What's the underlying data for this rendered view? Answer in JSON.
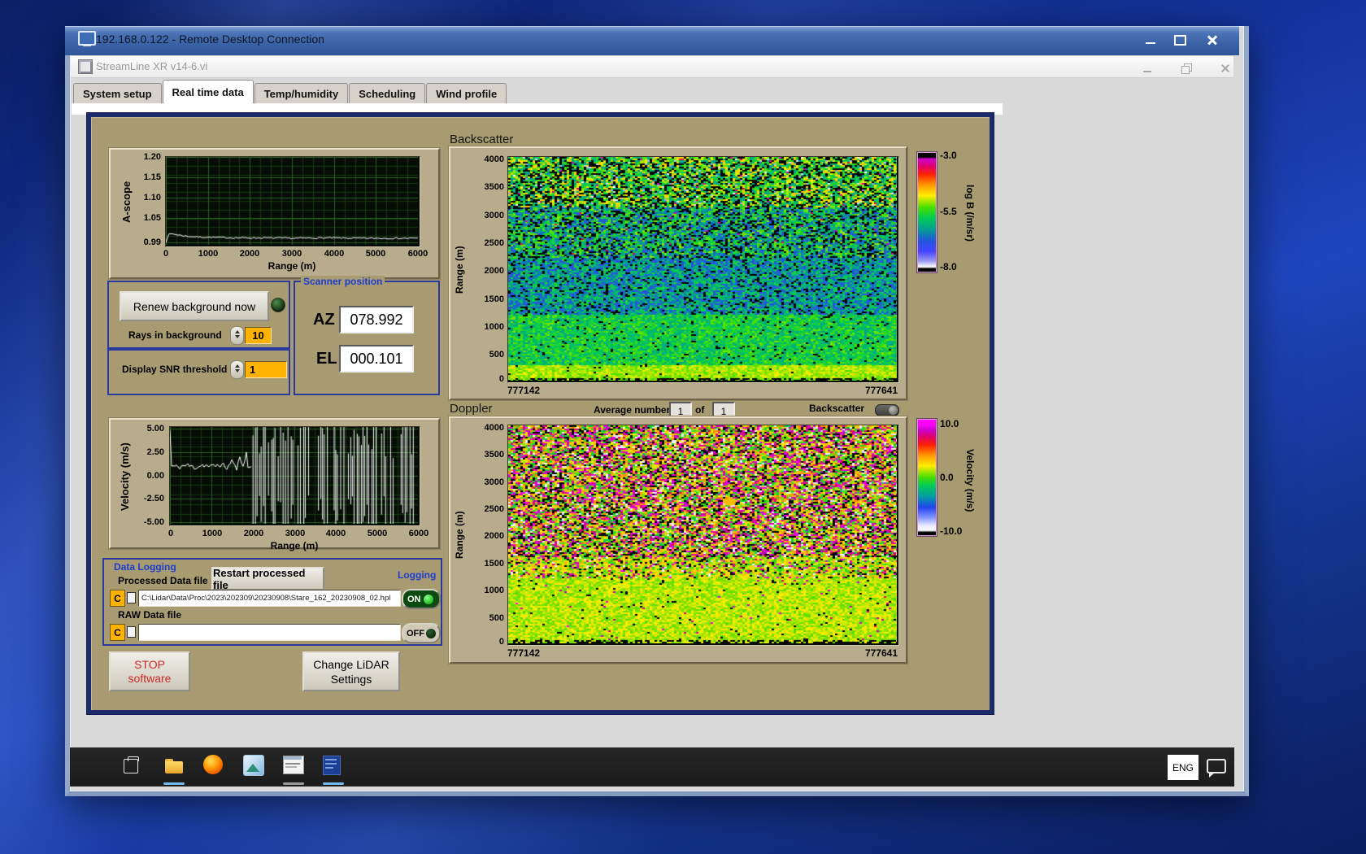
{
  "rdp": {
    "title": "192.168.0.122 - Remote Desktop Connection"
  },
  "vi": {
    "title": "StreamLine XR v14-6.vi"
  },
  "tabs": {
    "items": [
      {
        "label": "System setup"
      },
      {
        "label": "Real time data"
      },
      {
        "label": "Temp/humidity"
      },
      {
        "label": "Scheduling"
      },
      {
        "label": "Wind profile"
      }
    ],
    "active_index": 1
  },
  "ascope": {
    "ylabel": "A-scope",
    "xlabel": "Range (m)",
    "yticks": [
      "1.20",
      "1.15",
      "1.10",
      "1.05",
      "0.99"
    ],
    "xticks": [
      "0",
      "1000",
      "2000",
      "3000",
      "4000",
      "5000",
      "6000"
    ]
  },
  "background_controls": {
    "renew_button": "Renew background now",
    "rays_label": "Rays in background",
    "rays_value": "10",
    "snr_label": "Display SNR threshold",
    "snr_value": "1"
  },
  "scanner": {
    "title": "Scanner position",
    "az_label": "AZ",
    "az_value": "078.992",
    "el_label": "EL",
    "el_value": "000.101"
  },
  "velocity_plot": {
    "ylabel": "Velocity (m/s)",
    "xlabel": "Range (m)",
    "yticks": [
      "5.00",
      "2.50",
      "0.00",
      "-2.50",
      "-5.00"
    ],
    "xticks": [
      "0",
      "1000",
      "2000",
      "3000",
      "4000",
      "5000",
      "6000"
    ]
  },
  "logging": {
    "title": "Data Logging",
    "processed_label": "Processed Data file",
    "restart_button": "Restart processed file",
    "logging_label": "Logging",
    "drive_letter": "C",
    "processed_path": "C:\\Lidar\\Data\\Proc\\2023\\202309\\20230908\\Stare_162_20230908_02.hpl",
    "on_label": "ON",
    "raw_label": "RAW Data file",
    "raw_path": "",
    "off_label": "OFF"
  },
  "actions": {
    "stop_line1": "STOP",
    "stop_line2": "software",
    "change_line1": "Change LiDAR",
    "change_line2": "Settings"
  },
  "backscatter_plot": {
    "title": "Backscatter",
    "ylabel": "Range (m)",
    "yticks": [
      "4000",
      "3500",
      "3000",
      "2500",
      "2000",
      "1500",
      "1000",
      "500",
      "0"
    ],
    "x_start": "777142",
    "x_end": "777641",
    "colorbar_ticks": [
      "-3.0",
      "-5.5",
      "-8.0"
    ],
    "colorbar_label": "log B (/m/sr)"
  },
  "doppler_plot": {
    "title": "Doppler",
    "avg_label": "Average number",
    "avg_value": "1",
    "of_label": "of",
    "of_count": "1",
    "toggle_label": "Backscatter",
    "ylabel": "Range (m)",
    "yticks": [
      "4000",
      "3500",
      "3000",
      "2500",
      "2000",
      "1500",
      "1000",
      "500",
      "0"
    ],
    "x_start": "777142",
    "x_end": "777641",
    "colorbar_ticks": [
      "10.0",
      "0.0",
      "-10.0"
    ],
    "colorbar_label": "Velocity (m/s)"
  },
  "taskbar": {
    "language": "ENG"
  },
  "colors": {
    "panel_tan": "#a89b72",
    "frame_beige": "#b9ac8c",
    "navy_border": "#1b2a6b",
    "label_blue": "#1e3ccc",
    "field_orange": "#ffb200",
    "led_on_green": "#2ee62e",
    "plot_bg": "#060c06"
  },
  "chart_data": [
    {
      "id": "ascope",
      "type": "line",
      "title": "",
      "ylabel": "A-scope",
      "xlabel": "Range (m)",
      "xlim": [
        0,
        6000
      ],
      "ylim": [
        0.985,
        1.2
      ],
      "xticks": [
        0,
        1000,
        2000,
        3000,
        4000,
        5000,
        6000
      ],
      "yticks": [
        1.2,
        1.15,
        1.1,
        1.05,
        0.99
      ],
      "points": [
        [
          0,
          0.992
        ],
        [
          60,
          1.01
        ],
        [
          150,
          1.012
        ],
        [
          300,
          1.009
        ],
        [
          500,
          1.006
        ],
        [
          800,
          1.004
        ],
        [
          1200,
          1.003
        ],
        [
          1700,
          1.002
        ],
        [
          2300,
          1.002
        ],
        [
          3000,
          1.001
        ],
        [
          3800,
          1.002
        ],
        [
          4600,
          1.001
        ],
        [
          5300,
          1.001
        ],
        [
          6000,
          1.001
        ]
      ],
      "jitter": 0.0018,
      "seed": 7,
      "line_color": "#ffffff",
      "grid": true
    },
    {
      "id": "velocity",
      "type": "line",
      "title": "",
      "ylabel": "Velocity (m/s)",
      "xlabel": "Range (m)",
      "xlim": [
        0,
        6000
      ],
      "ylim": [
        -5.2,
        5.2
      ],
      "xticks": [
        0,
        1000,
        2000,
        3000,
        4000,
        5000,
        6000
      ],
      "yticks": [
        5.0,
        2.5,
        0.0,
        -2.5,
        -5.0
      ],
      "points": [
        [
          0,
          4.9
        ],
        [
          25,
          1.0
        ],
        [
          200,
          0.9
        ],
        [
          400,
          1.1
        ],
        [
          600,
          0.85
        ],
        [
          800,
          1.15
        ],
        [
          1000,
          0.9
        ],
        [
          1200,
          1.2
        ],
        [
          1400,
          0.8
        ],
        [
          1500,
          1.7
        ],
        [
          1600,
          0.6
        ],
        [
          1700,
          1.9
        ],
        [
          1750,
          1.0
        ],
        [
          1850,
          2.3
        ],
        [
          1900,
          0.4
        ],
        [
          1950,
          1.2
        ],
        [
          2000,
          0.8
        ]
      ],
      "jitter": 0.3,
      "noise_region": [
        2000,
        6000
      ],
      "noise_gap_prob": 0.13,
      "seed": 11,
      "line_color": "#ffffff",
      "grid": true
    },
    {
      "id": "backscatter",
      "type": "heatmap",
      "title": "Backscatter",
      "ylabel": "Range (m)",
      "ylim": [
        0,
        4000
      ],
      "yticks": [
        4000,
        3500,
        3000,
        2500,
        2000,
        1500,
        1000,
        500,
        0
      ],
      "x_start": 777142,
      "x_end": 777641,
      "vmax": -3.0,
      "vmin": -8.0,
      "colorbar_label": "log B (/m/sr)",
      "colorbar_ticks": [
        -3.0,
        -5.5,
        -8.0
      ],
      "seed": 21,
      "stops": [
        [
          0,
          "#cc00cc"
        ],
        [
          0.08,
          "#e00070"
        ],
        [
          0.16,
          "#ff2200"
        ],
        [
          0.26,
          "#ff9900"
        ],
        [
          0.36,
          "#ffee00"
        ],
        [
          0.46,
          "#44e000"
        ],
        [
          0.55,
          "#00cc55"
        ],
        [
          0.65,
          "#00a090"
        ],
        [
          0.75,
          "#2255dd"
        ],
        [
          0.85,
          "#4444ff"
        ],
        [
          0.93,
          "#9a9aee"
        ],
        [
          1,
          "#ffffff"
        ]
      ],
      "bands": [
        {
          "range": [
            0,
            0.012
          ],
          "base": -5.2,
          "noise": 0.3,
          "p_black": 0.5
        },
        {
          "range": [
            0.012,
            0.07
          ],
          "base": -5.05,
          "noise": 0.25,
          "p_black": 0.02
        },
        {
          "range": [
            0.07,
            0.3
          ],
          "base": -5.7,
          "noise": 0.55,
          "p_black": 0.05
        },
        {
          "range": [
            0.3,
            0.55
          ],
          "base": -6.25,
          "noise": 0.75,
          "p_black": 0.13
        },
        {
          "range": [
            0.55,
            0.78
          ],
          "base": -6.0,
          "noise": 0.95,
          "p_black": 0.22,
          "p_high": 0.01
        },
        {
          "range": [
            0.78,
            1.01
          ],
          "base": -5.45,
          "noise": 0.95,
          "p_black": 0.28,
          "p_high": 0.015,
          "p_low": 0.04
        }
      ]
    },
    {
      "id": "doppler",
      "type": "heatmap",
      "title": "Doppler",
      "ylabel": "Range (m)",
      "ylim": [
        0,
        4000
      ],
      "yticks": [
        4000,
        3500,
        3000,
        2500,
        2000,
        1500,
        1000,
        500,
        0
      ],
      "x_start": 777142,
      "x_end": 777641,
      "vmax": 10.0,
      "vmin": -10.0,
      "colorbar_label": "Velocity (m/s)",
      "colorbar_ticks": [
        10.0,
        0.0,
        -10.0
      ],
      "seed": 33,
      "stops": [
        [
          0,
          "#ff00ff"
        ],
        [
          0.05,
          "#cc00cc"
        ],
        [
          0.12,
          "#e00066"
        ],
        [
          0.2,
          "#ff2200"
        ],
        [
          0.3,
          "#ff9900"
        ],
        [
          0.4,
          "#ffee00"
        ],
        [
          0.5,
          "#44dd00"
        ],
        [
          0.58,
          "#00cc55"
        ],
        [
          0.68,
          "#00a0a0"
        ],
        [
          0.78,
          "#2244ee"
        ],
        [
          0.88,
          "#8899ff"
        ],
        [
          0.95,
          "#eeeeff"
        ],
        [
          1,
          "#f8f8f8"
        ]
      ],
      "bands": [
        {
          "range": [
            0,
            0.015
          ],
          "base": 1.2,
          "noise": 1.0,
          "p_black": 0.45
        },
        {
          "range": [
            0.015,
            0.3
          ],
          "base": 1.2,
          "noise": 1.1,
          "p_black": 0.02,
          "p_high": 0.008
        },
        {
          "range": [
            0.3,
            0.4
          ],
          "base": 1.4,
          "noise": 2.2,
          "p_black": 0.1,
          "p_high": 0.1,
          "p_low": 0.04
        },
        {
          "range": [
            0.4,
            1.01
          ],
          "base": 1.5,
          "noise": 3.2,
          "p_black": 0.17,
          "p_high": 0.27,
          "p_low": 0.09
        }
      ],
      "spots": [
        {
          "cx": 0.57,
          "cy": 0.35,
          "r": 8,
          "v": 3.2
        }
      ]
    }
  ]
}
